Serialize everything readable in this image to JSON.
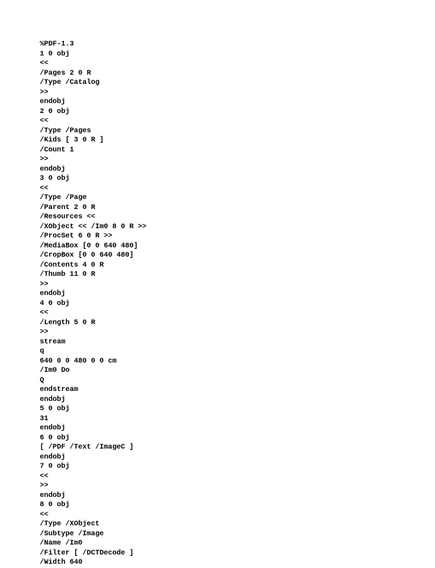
{
  "doc": {
    "lines": [
      "%PDF-1.3",
      "1 0 obj",
      "<<",
      "/Pages 2 0 R",
      "/Type /Catalog",
      ">>",
      "endobj",
      "2 0 obj",
      "<<",
      "/Type /Pages",
      "/Kids [ 3 0 R ]",
      "/Count 1",
      ">>",
      "endobj",
      "3 0 obj",
      "<<",
      "/Type /Page",
      "/Parent 2 0 R",
      "/Resources <<",
      "/XObject << /Im0 8 0 R >>",
      "/ProcSet 6 0 R >>",
      "/MediaBox [0 0 640 480]",
      "/CropBox [0 0 640 480]",
      "/Contents 4 0 R",
      "/Thumb 11 0 R",
      ">>",
      "endobj",
      "4 0 obj",
      "<<",
      "/Length 5 0 R",
      ">>",
      "stream",
      "q",
      "640 0 0 480 0 0 cm",
      "/Im0 Do",
      "Q",
      "",
      "endstream",
      "endobj",
      "5 0 obj",
      "31",
      "endobj",
      "6 0 obj",
      "[ /PDF /Text /ImageC ]",
      "endobj",
      "7 0 obj",
      "<<",
      ">>",
      "endobj",
      "8 0 obj",
      "<<",
      "/Type /XObject",
      "/Subtype /Image",
      "/Name /Im0",
      "/Filter [ /DCTDecode ]",
      "/Width 640"
    ]
  }
}
